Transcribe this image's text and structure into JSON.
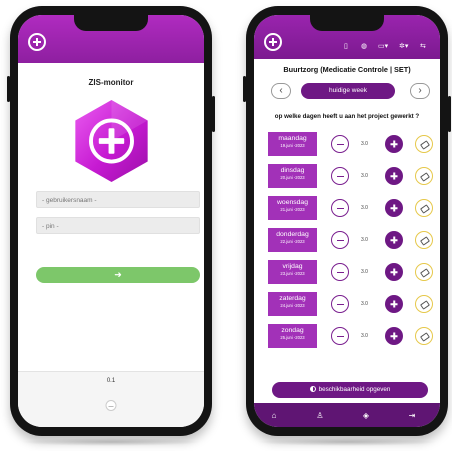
{
  "login": {
    "title": "ZIS-monitor",
    "username_placeholder": "- gebruikersnaam -",
    "pin_placeholder": "- pin -",
    "login_icon": "arrow-right-icon",
    "version": "0.1",
    "logo_icon": "hexagon-plus-icon",
    "header_icon": "plus-circle-icon"
  },
  "app": {
    "title": "Buurtzorg (Medicatie Controle | SET)",
    "prev_label": "‹",
    "next_label": "›",
    "week_label": "huidige week",
    "question": "op welke dagen heeft u aan het project gewerkt ?",
    "days": [
      {
        "name": "maandag",
        "date": "19.juni -2023",
        "value": "3.0"
      },
      {
        "name": "dinsdag",
        "date": "20.juni -2023",
        "value": "3.0"
      },
      {
        "name": "woensdag",
        "date": "21.juni -2023",
        "value": "3.0"
      },
      {
        "name": "donderdag",
        "date": "22.juni -2023",
        "value": "3.0"
      },
      {
        "name": "vrijdag",
        "date": "23.juni -2023",
        "value": "3.0"
      },
      {
        "name": "zaterdag",
        "date": "24.juni -2023",
        "value": "3.0"
      },
      {
        "name": "zondag",
        "date": "25.juni -2023",
        "value": "3.0"
      }
    ],
    "availability_button": "beschikbaarheid opgeven",
    "header_icons": [
      "plus-circle-icon",
      "tablet-icon",
      "globe-icon",
      "monitor-icon",
      "settings-icon",
      "sliders-icon"
    ],
    "footer_icons": [
      "home-icon",
      "user-icon",
      "layers-icon",
      "logout-icon"
    ]
  },
  "colors": {
    "purple": "#6e1884",
    "header_purple": "#9a24ae",
    "day_purple": "#a231b8",
    "green": "#7dc76a",
    "yellow_outline": "#e6c84a"
  }
}
